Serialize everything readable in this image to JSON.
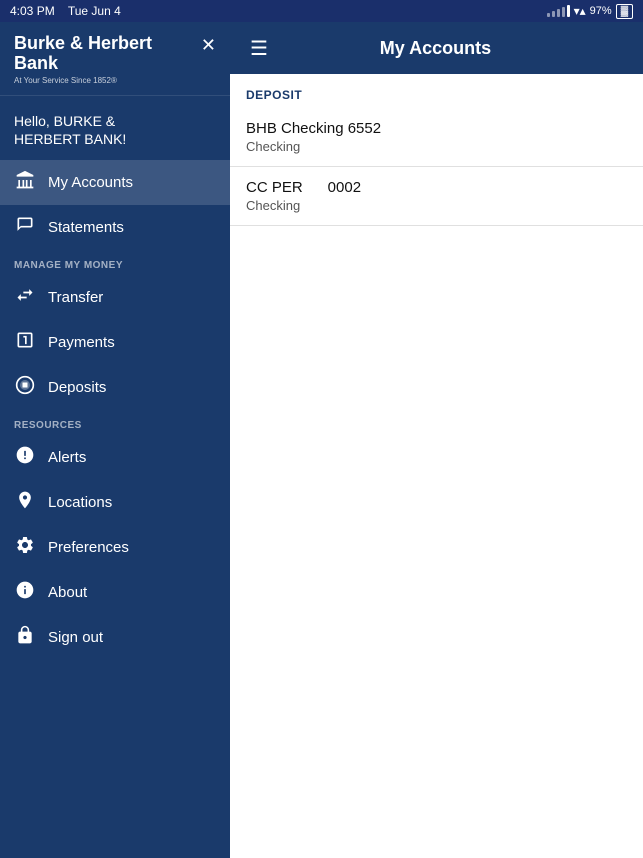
{
  "statusBar": {
    "time": "4:03 PM",
    "date": "Tue Jun 4",
    "battery": "97%",
    "wifi": true
  },
  "sidebar": {
    "bankName": "Burke & Herbert Bank",
    "bankNameLine1": "Burke & Herbert",
    "bankNameLine2": "Bank",
    "tagline": "At Your Service Since 1852®",
    "greeting": "Hello, BURKE &\nHERBERT BANK!",
    "closeIcon": "✕",
    "navItems": [
      {
        "id": "my-accounts",
        "label": "My Accounts",
        "icon": "bank",
        "active": true
      },
      {
        "id": "statements",
        "label": "Statements",
        "icon": "statements"
      }
    ],
    "manageMoneyLabel": "MANAGE MY MONEY",
    "manageMoneyItems": [
      {
        "id": "transfer",
        "label": "Transfer",
        "icon": "transfer"
      },
      {
        "id": "payments",
        "label": "Payments",
        "icon": "payments"
      },
      {
        "id": "deposits",
        "label": "Deposits",
        "icon": "deposits"
      }
    ],
    "resourcesLabel": "RESOURCES",
    "resourceItems": [
      {
        "id": "alerts",
        "label": "Alerts",
        "icon": "alerts"
      },
      {
        "id": "locations",
        "label": "Locations",
        "icon": "location"
      },
      {
        "id": "preferences",
        "label": "Preferences",
        "icon": "preferences"
      },
      {
        "id": "about",
        "label": "About",
        "icon": "about"
      },
      {
        "id": "sign-out",
        "label": "Sign out",
        "icon": "signout"
      }
    ]
  },
  "main": {
    "title": "My Accounts",
    "sections": [
      {
        "sectionLabel": "DEPOSIT",
        "accounts": [
          {
            "name": "BHB Checking 6552",
            "type": "Checking"
          },
          {
            "name": "CC PER      0002",
            "type": "Checking"
          }
        ]
      }
    ]
  }
}
